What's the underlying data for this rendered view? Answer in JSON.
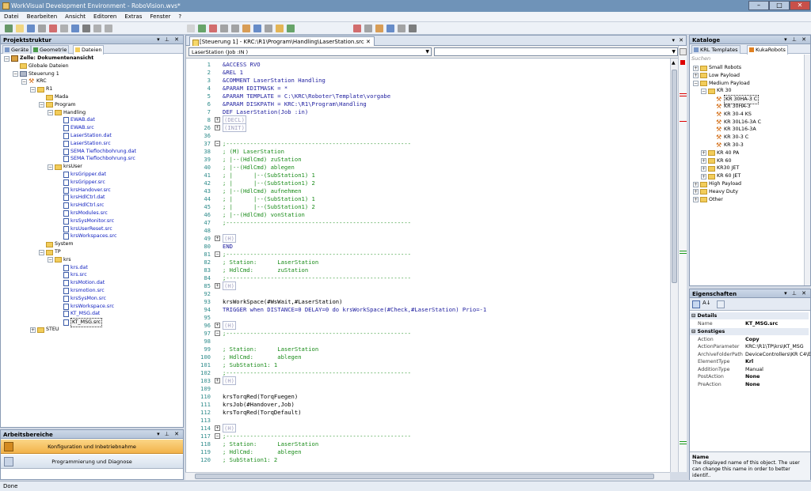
{
  "window": {
    "title": "WorkVisual Development Environment - RoboVision.wvs*",
    "min": "–",
    "max": "□",
    "close": "✕"
  },
  "menu": [
    "Datei",
    "Bearbeiten",
    "Ansicht",
    "Editoren",
    "Extras",
    "Fenster",
    "?"
  ],
  "project_panel": {
    "title": "Projektstruktur",
    "tabs": [
      "Geräte",
      "Geometrie",
      "Dateien"
    ],
    "tree": [
      {
        "label": "Zelle: Dokumentenansicht",
        "icon": "cell-icon",
        "indent": 0,
        "exp": "-",
        "bold": true
      },
      {
        "label": "Globale Dateien",
        "icon": "folder-icon",
        "indent": 1,
        "exp": ""
      },
      {
        "label": "Steuerung 1",
        "icon": "controller-icon",
        "indent": 1,
        "exp": "-"
      },
      {
        "label": "KRC",
        "icon": "robot-icon",
        "indent": 2,
        "exp": "-"
      },
      {
        "label": "R1",
        "icon": "folder-icon",
        "indent": 3,
        "exp": "-"
      },
      {
        "label": "Mada",
        "icon": "folder-icon",
        "indent": 4,
        "exp": ""
      },
      {
        "label": "Program",
        "icon": "folder-icon",
        "indent": 4,
        "exp": "-"
      },
      {
        "label": "Handling",
        "icon": "folder-icon",
        "indent": 5,
        "exp": "-"
      },
      {
        "label": "EWAB.dat",
        "icon": "file-icon",
        "indent": 6,
        "exp": "",
        "blue": true
      },
      {
        "label": "EWAB.src",
        "icon": "file-icon",
        "indent": 6,
        "exp": "",
        "blue": true
      },
      {
        "label": "LaserStation.dat",
        "icon": "file-icon",
        "indent": 6,
        "exp": "",
        "blue": true
      },
      {
        "label": "LaserStation.src",
        "icon": "file-icon",
        "indent": 6,
        "exp": "",
        "blue": true
      },
      {
        "label": "SEMA Tieflochbohrung.dat",
        "icon": "file-icon",
        "indent": 6,
        "exp": "",
        "blue": true
      },
      {
        "label": "SEMA Tieflochbohrung.src",
        "icon": "file-icon",
        "indent": 6,
        "exp": "",
        "blue": true
      },
      {
        "label": "krsUser",
        "icon": "folder-icon",
        "indent": 5,
        "exp": "-"
      },
      {
        "label": "krsGripper.dat",
        "icon": "file-icon",
        "indent": 6,
        "exp": "",
        "blue": true
      },
      {
        "label": "krsGripper.src",
        "icon": "file-icon",
        "indent": 6,
        "exp": "",
        "blue": true
      },
      {
        "label": "krsHandover.src",
        "icon": "file-icon",
        "indent": 6,
        "exp": "",
        "blue": true
      },
      {
        "label": "krsHdlCtrl.dat",
        "icon": "file-icon",
        "indent": 6,
        "exp": "",
        "blue": true
      },
      {
        "label": "krsHdlCtrl.src",
        "icon": "file-icon",
        "indent": 6,
        "exp": "",
        "blue": true
      },
      {
        "label": "krsModules.src",
        "icon": "file-icon",
        "indent": 6,
        "exp": "",
        "blue": true
      },
      {
        "label": "krsSysMonitor.src",
        "icon": "file-icon",
        "indent": 6,
        "exp": "",
        "blue": true
      },
      {
        "label": "krsUserReset.src",
        "icon": "file-icon",
        "indent": 6,
        "exp": "",
        "blue": true
      },
      {
        "label": "krsWorkspaces.src",
        "icon": "file-icon",
        "indent": 6,
        "exp": "",
        "blue": true
      },
      {
        "label": "System",
        "icon": "folder-icon",
        "indent": 4,
        "exp": ""
      },
      {
        "label": "TP",
        "icon": "folder-icon",
        "indent": 4,
        "exp": "-"
      },
      {
        "label": "krs",
        "icon": "folder-icon",
        "indent": 5,
        "exp": "-"
      },
      {
        "label": "krs.dat",
        "icon": "file-icon",
        "indent": 6,
        "exp": "",
        "blue": true
      },
      {
        "label": "krs.src",
        "icon": "file-icon",
        "indent": 6,
        "exp": "",
        "blue": true
      },
      {
        "label": "krsMotion.dat",
        "icon": "file-icon",
        "indent": 6,
        "exp": "",
        "blue": true
      },
      {
        "label": "krsmotion.src",
        "icon": "file-icon",
        "indent": 6,
        "exp": "",
        "blue": true
      },
      {
        "label": "krsSysMon.src",
        "icon": "file-icon",
        "indent": 6,
        "exp": "",
        "blue": true
      },
      {
        "label": "krsWorkspace.src",
        "icon": "file-icon",
        "indent": 6,
        "exp": "",
        "blue": true
      },
      {
        "label": "KT_MSG.dat",
        "icon": "file-icon",
        "indent": 6,
        "exp": "",
        "blue": true
      },
      {
        "label": "KT_MSG.src",
        "icon": "file-icon",
        "indent": 6,
        "exp": "",
        "selected": true
      },
      {
        "label": "STEU",
        "icon": "folder-icon",
        "indent": 3,
        "exp": "+"
      }
    ]
  },
  "work_areas": {
    "title": "Arbeitsbereiche",
    "items": [
      "Konfiguration und Inbetriebnahme",
      "Programmierung und Diagnose"
    ]
  },
  "editor": {
    "doc_tab": "[Steuerung 1] - KRC:\\R1\\Program\\Handling\\LaserStation.src",
    "module_combo": "LaserStation (Job :IN )",
    "func_combo": "",
    "lines": [
      {
        "n": "1",
        "t": "&ACCESS RVO",
        "c": "kw"
      },
      {
        "n": "2",
        "t": "&REL 1",
        "c": "kw"
      },
      {
        "n": "3",
        "t": "&COMMENT LaserStation Handling",
        "c": "kw"
      },
      {
        "n": "4",
        "t": "&PARAM EDITMASK = *",
        "c": "kw"
      },
      {
        "n": "5",
        "t": "&PARAM TEMPLATE = C:\\KRC\\Roboter\\Template\\vorgabe",
        "c": "kw"
      },
      {
        "n": "6",
        "t": "&PARAM DISKPATH = KRC:\\R1\\Program\\Handling",
        "c": "kw"
      },
      {
        "n": "7",
        "t": "DEF LaserStation(Job :in)",
        "c": "kw"
      },
      {
        "n": "8",
        "t": "(DECL)",
        "c": "fd",
        "fold": "+"
      },
      {
        "n": "26",
        "t": "(INIT)",
        "c": "fd",
        "fold": "+"
      },
      {
        "n": "36",
        "t": "",
        "c": ""
      },
      {
        "n": "37",
        "t": ";------------------------------------------------------",
        "c": "cm",
        "fold": "-"
      },
      {
        "n": "38",
        "t": "; (M) LaserStation",
        "c": "cm"
      },
      {
        "n": "39",
        "t": "; |--(HdlCmd) zuStation",
        "c": "cm"
      },
      {
        "n": "40",
        "t": "; |--(HdlCmd) ablegen",
        "c": "cm"
      },
      {
        "n": "41",
        "t": "; |      |--(SubStation1) 1",
        "c": "cm"
      },
      {
        "n": "42",
        "t": "; |      |--(SubStation1) 2",
        "c": "cm"
      },
      {
        "n": "43",
        "t": "; |--(HdlCmd) aufnehmen",
        "c": "cm"
      },
      {
        "n": "44",
        "t": "; |      |--(SubStation1) 1",
        "c": "cm"
      },
      {
        "n": "45",
        "t": "; |      |--(SubStation1) 2",
        "c": "cm"
      },
      {
        "n": "46",
        "t": "; |--(HdlCmd) vonStation",
        "c": "cm"
      },
      {
        "n": "47",
        "t": ";------------------------------------------------------",
        "c": "cm"
      },
      {
        "n": "48",
        "t": "",
        "c": ""
      },
      {
        "n": "49",
        "t": "(H)",
        "c": "fd",
        "fold": "+"
      },
      {
        "n": "80",
        "t": "END",
        "c": "kw"
      },
      {
        "n": "81",
        "t": ";------------------------------------------------------",
        "c": "cm",
        "fold": "-"
      },
      {
        "n": "82",
        "t": "; Station:      LaserStation",
        "c": "cm"
      },
      {
        "n": "83",
        "t": "; HdlCmd:       zuStation",
        "c": "cm"
      },
      {
        "n": "84",
        "t": ";------------------------------------------------------",
        "c": "cm"
      },
      {
        "n": "85",
        "t": "(H)",
        "c": "fd",
        "fold": "+"
      },
      {
        "n": "92",
        "t": "",
        "c": ""
      },
      {
        "n": "93",
        "t": "krsWorkSpace(#WsWait,#LaserStation)",
        "c": ""
      },
      {
        "n": "94",
        "t": "TRIGGER when DISTANCE=0 DELAY=0 do krsWorkSpace(#Check,#LaserStation) Prio=-1",
        "c": "kw"
      },
      {
        "n": "95",
        "t": "",
        "c": ""
      },
      {
        "n": "96",
        "t": "(H)",
        "c": "fd",
        "fold": "+"
      },
      {
        "n": "97",
        "t": ";------------------------------------------------------",
        "c": "cm",
        "fold": "-"
      },
      {
        "n": "98",
        "t": "",
        "c": ""
      },
      {
        "n": "99",
        "t": "; Station:      LaserStation",
        "c": "cm"
      },
      {
        "n": "100",
        "t": "; HdlCmd:       ablegen",
        "c": "cm"
      },
      {
        "n": "101",
        "t": "; SubStation1: 1",
        "c": "cm"
      },
      {
        "n": "102",
        "t": ";------------------------------------------------------",
        "c": "cm"
      },
      {
        "n": "103",
        "t": "(H)",
        "c": "fd",
        "fold": "+"
      },
      {
        "n": "109",
        "t": "",
        "c": ""
      },
      {
        "n": "110",
        "t": "krsTorqRed(TorqFuegen)",
        "c": ""
      },
      {
        "n": "111",
        "t": "krsJob(#Handover,Job)",
        "c": ""
      },
      {
        "n": "112",
        "t": "krsTorqRed(TorqDefault)",
        "c": ""
      },
      {
        "n": "113",
        "t": "",
        "c": ""
      },
      {
        "n": "114",
        "t": "(H)",
        "c": "fd",
        "fold": "+"
      },
      {
        "n": "117",
        "t": ";------------------------------------------------------",
        "c": "cm",
        "fold": "-"
      },
      {
        "n": "118",
        "t": "; Station:      LaserStation",
        "c": "cm"
      },
      {
        "n": "119",
        "t": "; HdlCmd:       ablegen",
        "c": "cm"
      },
      {
        "n": "120",
        "t": "; SubStation1: 2",
        "c": "cm"
      }
    ]
  },
  "catalog": {
    "title": "Kataloge",
    "tabs": [
      "KRL Templates",
      "KukaRobots"
    ],
    "search_placeholder": "Suchen",
    "tree": [
      {
        "label": "Small Robots",
        "icon": "folder-icon",
        "indent": 0,
        "exp": "+"
      },
      {
        "label": "Low Payload",
        "icon": "folder-icon",
        "indent": 0,
        "exp": "+"
      },
      {
        "label": "Medium Payload",
        "icon": "folder-icon",
        "indent": 0,
        "exp": "-"
      },
      {
        "label": "KR 30",
        "icon": "folder-icon",
        "indent": 1,
        "exp": "-"
      },
      {
        "label": "KR 30HA-3 C",
        "icon": "robot-icon",
        "indent": 2,
        "exp": "",
        "selected": true
      },
      {
        "label": "KR 30HA-3",
        "icon": "robot-icon",
        "indent": 2,
        "exp": ""
      },
      {
        "label": "KR 30-4 KS",
        "icon": "robot-icon",
        "indent": 2,
        "exp": ""
      },
      {
        "label": "KR 30L16-3A C",
        "icon": "robot-icon",
        "indent": 2,
        "exp": ""
      },
      {
        "label": "KR 30L16-3A",
        "icon": "robot-icon",
        "indent": 2,
        "exp": ""
      },
      {
        "label": "KR 30-3 C",
        "icon": "robot-icon",
        "indent": 2,
        "exp": ""
      },
      {
        "label": "KR 30-3",
        "icon": "robot-icon",
        "indent": 2,
        "exp": ""
      },
      {
        "label": "KR 40 PA",
        "icon": "folder-icon",
        "indent": 1,
        "exp": "+"
      },
      {
        "label": "KR 60",
        "icon": "folder-icon",
        "indent": 1,
        "exp": "+"
      },
      {
        "label": "KR30 JET",
        "icon": "folder-icon",
        "indent": 1,
        "exp": "+"
      },
      {
        "label": "KR 60 JET",
        "icon": "folder-icon",
        "indent": 1,
        "exp": "+"
      },
      {
        "label": "High Payload",
        "icon": "folder-icon",
        "indent": 0,
        "exp": "+"
      },
      {
        "label": "Heavy Duty",
        "icon": "folder-icon",
        "indent": 0,
        "exp": "+"
      },
      {
        "label": "Other",
        "icon": "folder-icon",
        "indent": 0,
        "exp": "+"
      }
    ]
  },
  "properties": {
    "title": "Eigenschaften",
    "categories": [
      {
        "name": "Details",
        "rows": [
          {
            "k": "Name",
            "v": "KT_MSG.src",
            "bold": true
          }
        ]
      },
      {
        "name": "Sonstiges",
        "rows": [
          {
            "k": "Action",
            "v": "Copy",
            "bold": true
          },
          {
            "k": "ActionParameter",
            "v": "KRC:\\R1\\TP\\krs\\KT_MSG"
          },
          {
            "k": "ArchiveFolderPath",
            "v": "DeviceControllers\\KR C4\\E"
          },
          {
            "k": "ElementType",
            "v": "Krl",
            "bold": true
          },
          {
            "k": "AdditionType",
            "v": "Manual"
          },
          {
            "k": "PostAction",
            "v": "None",
            "bold": true
          },
          {
            "k": "PreAction",
            "v": "None",
            "bold": true
          }
        ]
      }
    ],
    "desc_title": "Name",
    "desc_text": "The displayed name of this object. The user can change this name in order to better identif.."
  },
  "status": "Done"
}
